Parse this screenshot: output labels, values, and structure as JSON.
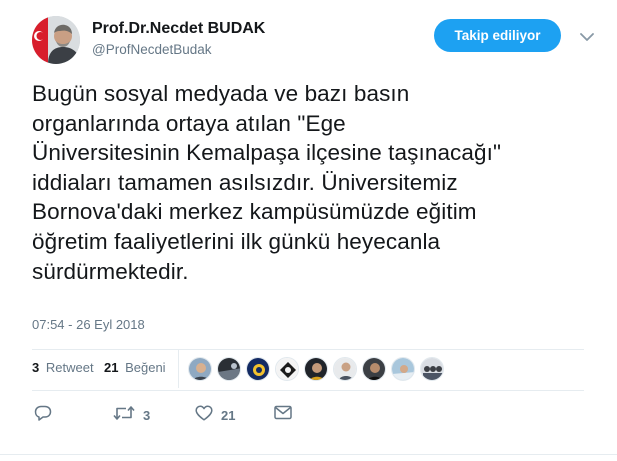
{
  "author": {
    "name": "Prof.Dr.Necdet BUDAK",
    "handle": "@ProfNecdetBudak"
  },
  "follow_button": {
    "label": "Takip ediliyor"
  },
  "tweet": {
    "lines": [
      "Bugün sosyal medyada ve bazı basın",
      "organlarında ortaya atılan \"Ege",
      "Üniversitesinin Kemalpaşa ilçesine taşınacağı\"",
      "iddiaları tamamen asılsızdır. Üniversitemiz",
      "Bornova'daki merkez kampüsümüzde eğitim",
      "öğretim faaliyetlerini ilk günkü heyecanla",
      "sürdürmektedir."
    ],
    "timestamp": "07:54 - 26 Eyl 2018"
  },
  "stats": {
    "retweet_count": "3",
    "retweet_label": "Retweet",
    "like_count": "21",
    "like_label": "Beğeni"
  },
  "likers": [
    {
      "icon": "user-avatar"
    },
    {
      "icon": "user-avatar"
    },
    {
      "icon": "user-avatar"
    },
    {
      "icon": "user-avatar"
    },
    {
      "icon": "user-avatar"
    },
    {
      "icon": "user-avatar"
    },
    {
      "icon": "user-avatar"
    },
    {
      "icon": "user-avatar"
    },
    {
      "icon": "user-avatar"
    }
  ],
  "actions": {
    "reply_icon": "reply-icon",
    "retweet_icon": "retweet-icon",
    "retweet_count": "3",
    "like_icon": "heart-icon",
    "like_count": "21",
    "dm_icon": "envelope-icon"
  },
  "colors": {
    "accent": "#1da1f2",
    "secondary_text": "#657786",
    "divider": "#e6ecf0"
  }
}
